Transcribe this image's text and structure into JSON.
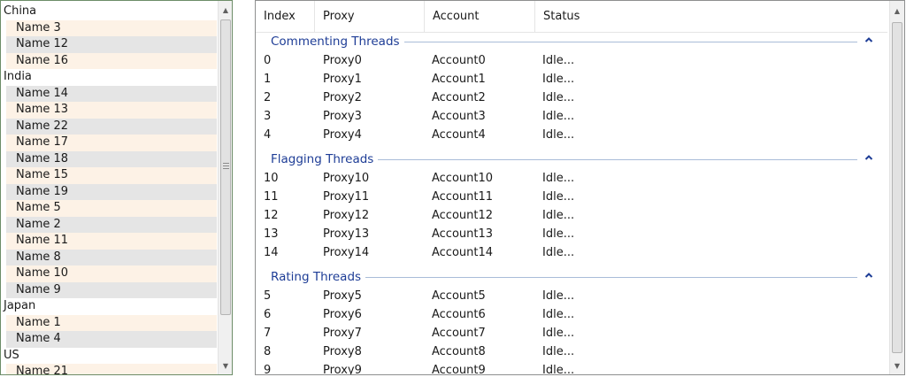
{
  "tree": {
    "groups": [
      {
        "label": "China",
        "items": [
          "Name 3",
          "Name 12",
          "Name 16"
        ]
      },
      {
        "label": "India",
        "items": [
          "Name 14",
          "Name 13",
          "Name 22",
          "Name 17",
          "Name 18",
          "Name 15",
          "Name 19",
          "Name 5",
          "Name 2",
          "Name 11",
          "Name 8",
          "Name 10",
          "Name 9"
        ]
      },
      {
        "label": "Japan",
        "items": [
          "Name 1",
          "Name 4"
        ]
      },
      {
        "label": "US",
        "items": [
          "Name 21"
        ]
      }
    ]
  },
  "list": {
    "columns": [
      "Index",
      "Proxy",
      "Account",
      "Status"
    ],
    "groups": [
      {
        "title": "Commenting Threads",
        "rows": [
          [
            "0",
            "Proxy0",
            "Account0",
            "Idle..."
          ],
          [
            "1",
            "Proxy1",
            "Account1",
            "Idle..."
          ],
          [
            "2",
            "Proxy2",
            "Account2",
            "Idle..."
          ],
          [
            "3",
            "Proxy3",
            "Account3",
            "Idle..."
          ],
          [
            "4",
            "Proxy4",
            "Account4",
            "Idle..."
          ]
        ]
      },
      {
        "title": "Flagging Threads",
        "rows": [
          [
            "10",
            "Proxy10",
            "Account10",
            "Idle..."
          ],
          [
            "11",
            "Proxy11",
            "Account11",
            "Idle..."
          ],
          [
            "12",
            "Proxy12",
            "Account12",
            "Idle..."
          ],
          [
            "13",
            "Proxy13",
            "Account13",
            "Idle..."
          ],
          [
            "14",
            "Proxy14",
            "Account14",
            "Idle..."
          ]
        ]
      },
      {
        "title": "Rating Threads",
        "rows": [
          [
            "5",
            "Proxy5",
            "Account5",
            "Idle..."
          ],
          [
            "6",
            "Proxy6",
            "Account6",
            "Idle..."
          ],
          [
            "7",
            "Proxy7",
            "Account7",
            "Idle..."
          ],
          [
            "8",
            "Proxy8",
            "Account8",
            "Idle..."
          ],
          [
            "9",
            "Proxy9",
            "Account9",
            "Idle..."
          ]
        ]
      }
    ]
  },
  "icons": {
    "group_collapse": "chevron-up-icon",
    "scroll_up": "scroll-up-arrow-icon",
    "scroll_down": "scroll-down-arrow-icon"
  },
  "colors": {
    "group_title": "#1e3d96",
    "group_line": "#a9bcd8",
    "row_even": "#fdf2e6",
    "row_odd": "#e5e5e5"
  }
}
